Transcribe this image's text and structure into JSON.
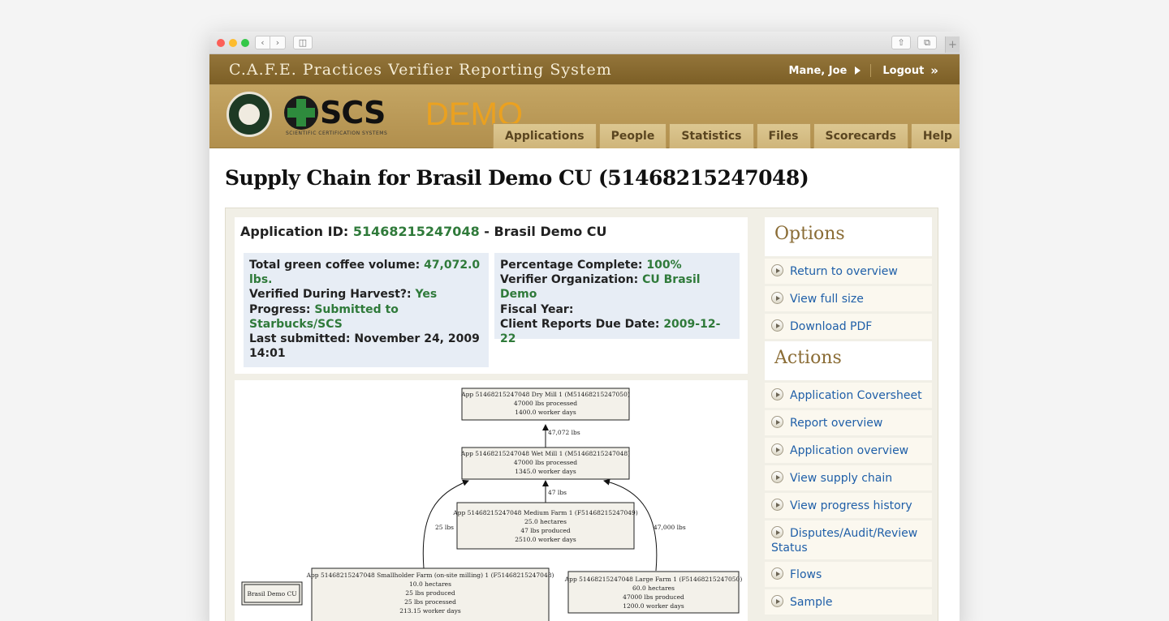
{
  "header": {
    "site_title": "C.A.F.E. Practices Verifier Reporting System",
    "user_name": "Mane, Joe",
    "logout_label": "Logout",
    "logo_starbucks": "STARBUCKS COFFEE",
    "logo_scs": "SCS",
    "logo_scs_sub": "SCIENTIFIC CERTIFICATION SYSTEMS",
    "demo_label": "DEMO"
  },
  "nav": [
    "Applications",
    "People",
    "Statistics",
    "Files",
    "Scorecards",
    "Help"
  ],
  "page": {
    "title": "Supply Chain for Brasil Demo CU (51468215247048)"
  },
  "application": {
    "label": "Application ID:",
    "id": "51468215247048",
    "name": "- Brasil Demo CU",
    "left": {
      "volume_label": "Total green coffee volume:",
      "volume_value": "47,072.0 lbs.",
      "harvest_label": "Verified During Harvest?:",
      "harvest_value": "Yes",
      "progress_label": "Progress:",
      "progress_value": "Submitted to Starbucks/SCS",
      "submitted_label": "Last submitted:",
      "submitted_value": "November 24, 2009 14:01"
    },
    "right": {
      "percent_label": "Percentage Complete:",
      "percent_value": "100%",
      "org_label": "Verifier Organization:",
      "org_value": "CU Brasil Demo",
      "fiscal_label": "Fiscal Year:",
      "fiscal_value": "",
      "due_label": "Client Reports Due Date:",
      "due_value": "2009-12-22"
    }
  },
  "supply_chain": {
    "nodes": {
      "dry_mill": [
        "App 51468215247048 Dry Mill 1  (M51468215247050)",
        "47000 lbs processed",
        "1400.0 worker days"
      ],
      "wet_mill": [
        "App 51468215247048 Wet Mill 1  (M51468215247048)",
        "47000 lbs processed",
        "1345.0 worker days"
      ],
      "medium_farm": [
        "App 51468215247048 Medium Farm 1  (F51468215247049)",
        "25.0 hectares",
        "47 lbs produced",
        "2510.0 worker days"
      ],
      "smallholder_farm": [
        "App 51468215247048 Smallholder Farm (on-site milling) 1  (F51468215247048)",
        "10.0 hectares",
        "25 lbs produced",
        "25 lbs processed",
        "213.15 worker days"
      ],
      "large_farm": [
        "App 51468215247048 Large Farm 1  (F51468215247050)",
        "60.0 hectares",
        "47000 lbs produced",
        "1200.0 worker days"
      ],
      "cu": [
        "Brasil Demo CU"
      ]
    },
    "edges": {
      "wet_to_dry": "47,072 lbs",
      "medium_to_wet": "47 lbs",
      "small_to_wet": "25 lbs",
      "large_to_wet": "47,000 lbs"
    }
  },
  "options": {
    "heading": "Options",
    "items": [
      "Return to overview",
      "View full size",
      "Download PDF"
    ]
  },
  "actions": {
    "heading": "Actions",
    "items": [
      "Application Coversheet",
      "Report overview",
      "Application overview",
      "View supply chain",
      "View progress history",
      "Disputes/Audit/Review Status",
      "Flows",
      "Sample"
    ]
  }
}
